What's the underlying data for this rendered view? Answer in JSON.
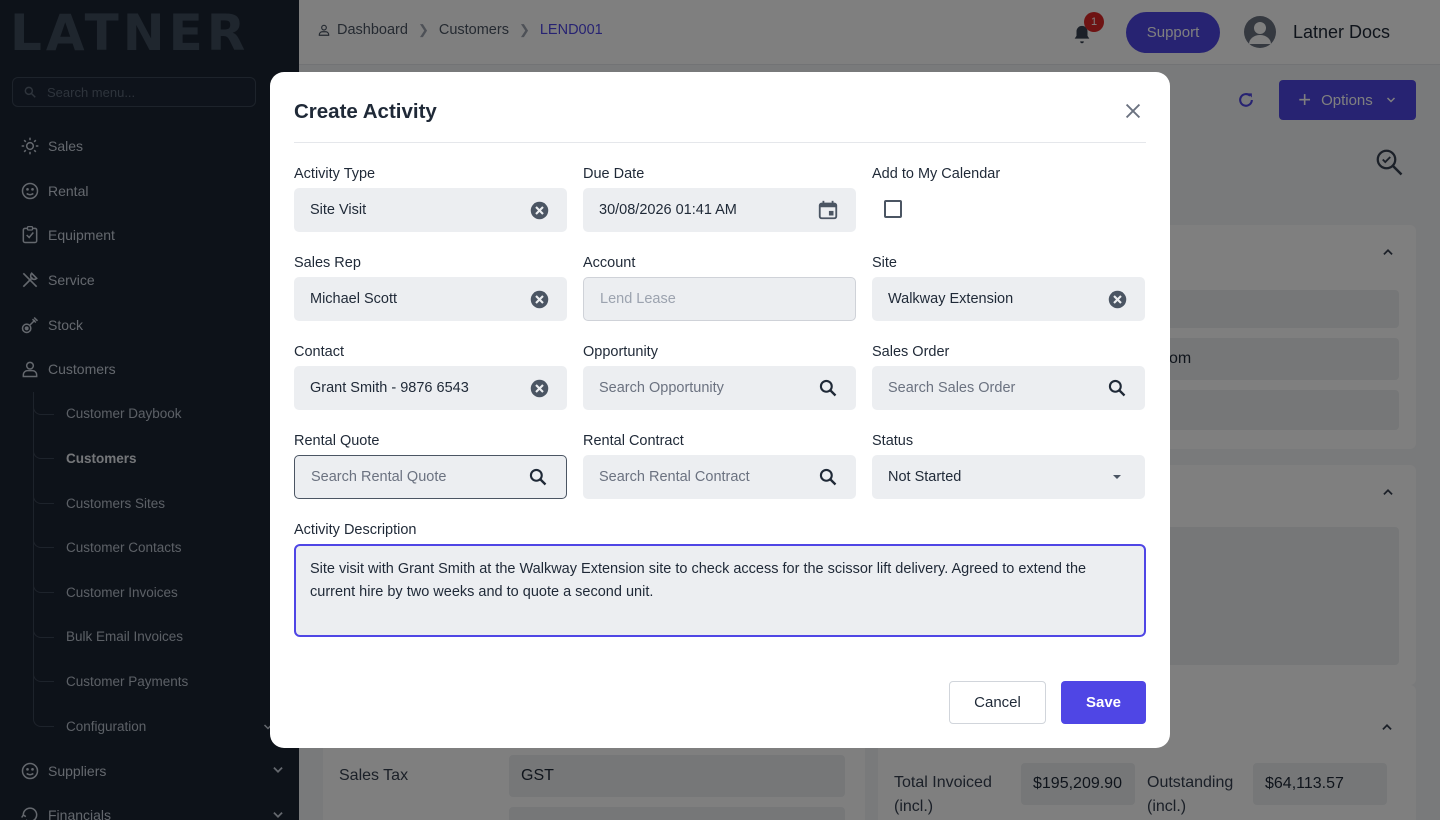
{
  "sidebar": {
    "logo": "LATNER",
    "search_placeholder": "Search menu...",
    "items": [
      {
        "label": "Sales",
        "icon": "sales-icon"
      },
      {
        "label": "Rental",
        "icon": "rental-icon"
      },
      {
        "label": "Equipment",
        "icon": "equipment-icon"
      },
      {
        "label": "Service",
        "icon": "service-icon"
      },
      {
        "label": "Stock",
        "icon": "stock-icon"
      },
      {
        "label": "Customers",
        "icon": "customers-icon"
      }
    ],
    "customer_sub": [
      "Customer Daybook",
      "Customers",
      "Customers Sites",
      "Customer Contacts",
      "Customer Invoices",
      "Bulk Email Invoices",
      "Customer Payments",
      "Configuration"
    ],
    "bottom_items": [
      {
        "label": "Suppliers",
        "icon": "suppliers-icon"
      },
      {
        "label": "Financials",
        "icon": "financials-icon"
      }
    ]
  },
  "header": {
    "breadcrumb": [
      "Dashboard",
      "Customers",
      "LEND001"
    ],
    "notifications": "1",
    "support": "Support",
    "user": "Latner Docs"
  },
  "main": {
    "options": "Options",
    "partial_email": "com",
    "sales_tax_label": "Sales Tax",
    "sales_tax_value": "GST",
    "total_invoiced_label": "Total Invoiced (incl.)",
    "total_invoiced_value": "$195,209.90",
    "outstanding_label": "Outstanding (incl.)",
    "outstanding_value": "$64,113.57"
  },
  "modal": {
    "title": "Create Activity",
    "fields": {
      "activity_type": {
        "label": "Activity Type",
        "value": "Site Visit"
      },
      "due_date": {
        "label": "Due Date",
        "value": "30/08/2026 01:41 AM"
      },
      "calendar": {
        "label": "Add to My Calendar",
        "checked": false
      },
      "sales_rep": {
        "label": "Sales Rep",
        "value": "Michael Scott"
      },
      "account": {
        "label": "Account",
        "placeholder": "Lend Lease"
      },
      "site": {
        "label": "Site",
        "value": "Walkway Extension"
      },
      "contact": {
        "label": "Contact",
        "value": "Grant Smith - 9876 6543"
      },
      "opportunity": {
        "label": "Opportunity",
        "placeholder": "Search Opportunity"
      },
      "sales_order": {
        "label": "Sales Order",
        "placeholder": "Search Sales Order"
      },
      "rental_quote": {
        "label": "Rental Quote",
        "placeholder": "Search Rental Quote"
      },
      "rental_contract": {
        "label": "Rental Contract",
        "placeholder": "Search Rental Contract"
      },
      "status": {
        "label": "Status",
        "value": "Not Started"
      },
      "description": {
        "label": "Activity Description",
        "value": "Site visit with Grant Smith at the Walkway Extension site to check access for the scissor lift delivery. Agreed to extend the current hire by two weeks and to quote a second unit."
      }
    },
    "cancel": "Cancel",
    "save": "Save"
  },
  "colors": {
    "accent": "#4f46e5",
    "sidebar_bg": "#1b2432",
    "badge": "#dc2626"
  }
}
